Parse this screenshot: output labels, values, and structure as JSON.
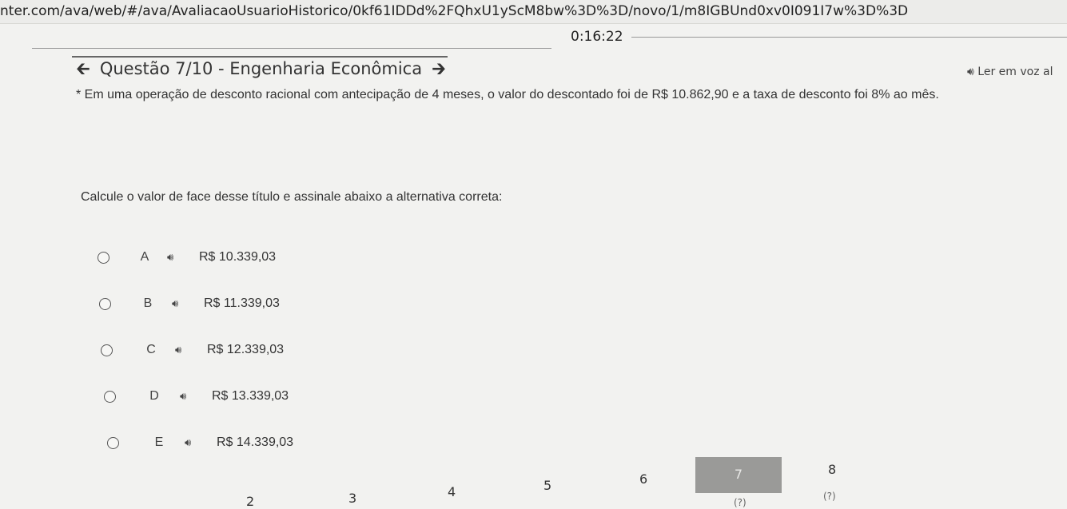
{
  "browser": {
    "url": "nter.com/ava/web/#/ava/AvaliacaoUsuarioHistorico/0kf61IDDd%2FQhxU1yScM8bw%3D%3D/novo/1/m8IGBUnd0xv0I091I7w%3D%3D"
  },
  "timer": "0:16:22",
  "question": {
    "prev_icon": "arrow-left-icon",
    "title": "Questão 7/10 - Engenharia Econômica",
    "next_icon": "arrow-right-icon",
    "read_aloud_label": "Ler em voz al",
    "statement": "* Em uma operação de desconto racional com antecipação de 4 meses, o valor do descontado foi de R$ 10.862,90 e a taxa de desconto foi 8% ao mês.",
    "prompt": "Calcule o valor de face desse título e assinale abaixo a alternativa correta:"
  },
  "options": [
    {
      "letter": "A",
      "text": "R$ 10.339,03"
    },
    {
      "letter": "B",
      "text": "R$ 11.339,03"
    },
    {
      "letter": "C",
      "text": "R$ 12.339,03"
    },
    {
      "letter": "D",
      "text": "R$ 13.339,03"
    },
    {
      "letter": "E",
      "text": "R$ 14.339,03"
    }
  ],
  "pagination": {
    "pages": [
      "2",
      "3",
      "4",
      "5",
      "6",
      "7",
      "8"
    ],
    "active": "7",
    "marks": [
      "(?)",
      "(?)"
    ]
  }
}
